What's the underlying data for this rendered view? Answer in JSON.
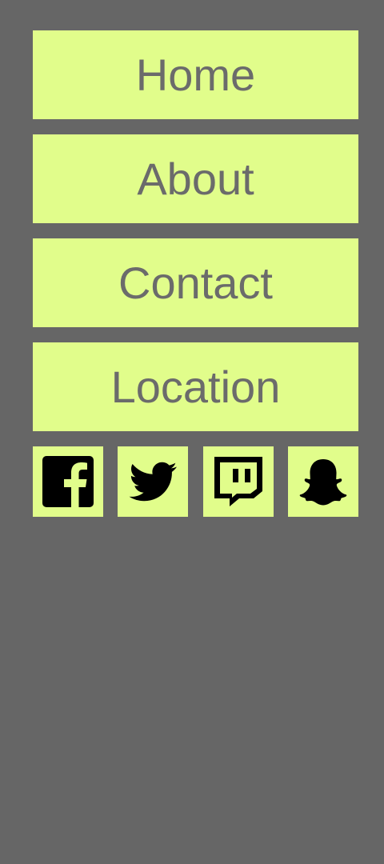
{
  "colors": {
    "background": "#666666",
    "button_bg": "#e1fd8b",
    "button_text": "#6b6b6b",
    "icon": "#000000"
  },
  "nav": {
    "items": [
      {
        "label": "Home"
      },
      {
        "label": "About"
      },
      {
        "label": "Contact"
      },
      {
        "label": "Location"
      }
    ]
  },
  "social": {
    "icons": [
      "facebook-icon",
      "twitter-icon",
      "twitch-icon",
      "snapchat-icon"
    ]
  }
}
